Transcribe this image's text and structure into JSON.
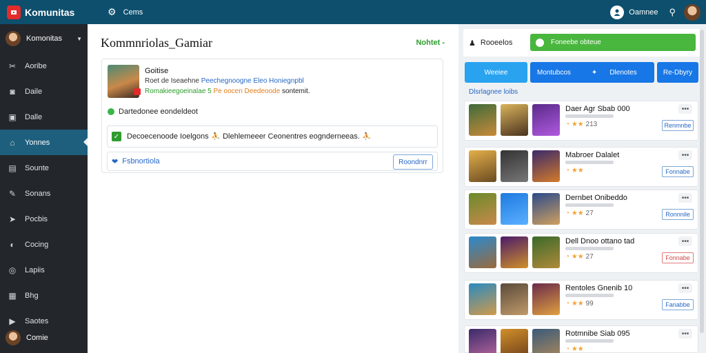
{
  "topbar": {
    "brand": "Komunitas",
    "link": "Cems",
    "user_name": "Oamnee"
  },
  "sidebar": {
    "user_name": "Komonitas",
    "items": [
      {
        "label": "Aoribe",
        "icon": "tools-icon"
      },
      {
        "label": "Daile",
        "icon": "camera-icon"
      },
      {
        "label": "Dalle",
        "icon": "briefcase-icon"
      },
      {
        "label": "Yonnes",
        "icon": "home-icon",
        "active": true
      },
      {
        "label": "Sounte",
        "icon": "bag-icon"
      },
      {
        "label": "Sonans",
        "icon": "wrench-icon"
      },
      {
        "label": "Pocbis",
        "icon": "megaphone-icon"
      },
      {
        "label": "Cocing",
        "icon": "chat-icon"
      },
      {
        "label": "Lapiis",
        "icon": "globe-icon"
      },
      {
        "label": "Bhg",
        "icon": "grid-icon"
      },
      {
        "label": "Saotes",
        "icon": "youtube-icon"
      }
    ],
    "bottom_label": "Comie"
  },
  "main": {
    "title": "Kommnriolas_Gamiar",
    "notify": "Nohtet -",
    "post": {
      "name": "Goitise",
      "desc_plain": "Roet de Iseaehne",
      "desc_link": "Peechegnoogne Eleo Honiegnpbl",
      "meta_green": "Romakieegoeinalae 5",
      "meta_orange": "Pe oocen Deedeoode",
      "meta_tail": "sontemit.",
      "status": "Dartedonee eondeldeot",
      "check_text_1": "Decoecenoode Ioelgons",
      "check_text_2": "Dlehlemeeer Ceonentres eognderneeas.",
      "reply_label": "Fsbnortiola",
      "reply_button": "Roondnrr"
    }
  },
  "right": {
    "head_label": "Rooeelos",
    "online_label": "Foneebe obteue",
    "tabs": [
      "Weeiee",
      "Montubcos",
      "Dlenotes",
      "Re-Dbyry"
    ],
    "filter_label": "Dlsrlagnee loibs",
    "games": [
      {
        "title": "Daer Agr Sbab 000",
        "rating": "213",
        "button": "Renmnbe",
        "btn_style": "blue"
      },
      {
        "title": "Mabroer Dalalet",
        "rating": "",
        "button": "Fonnabe",
        "btn_style": "blue"
      },
      {
        "title": "Dernbet Onibeddo",
        "rating": "27",
        "button": "Ronnnile",
        "btn_style": "blue"
      },
      {
        "title": "Dell Dnoo ottano tad",
        "rating": "27",
        "button": "Fonnabe",
        "btn_style": "red"
      },
      {
        "title": "Rentoles Gnenib 10",
        "rating": "99",
        "button": "Fanabbe",
        "btn_style": "blue"
      },
      {
        "title": "Rotmnibe Siab 095",
        "rating": "",
        "button": "",
        "btn_style": "blue"
      }
    ]
  },
  "colors": {
    "topbar": "#0d4f6d",
    "sidebar": "#23272c",
    "active_item": "#1e5f7e",
    "online_green": "#49b63d",
    "tab_blue": "#1777e6"
  }
}
